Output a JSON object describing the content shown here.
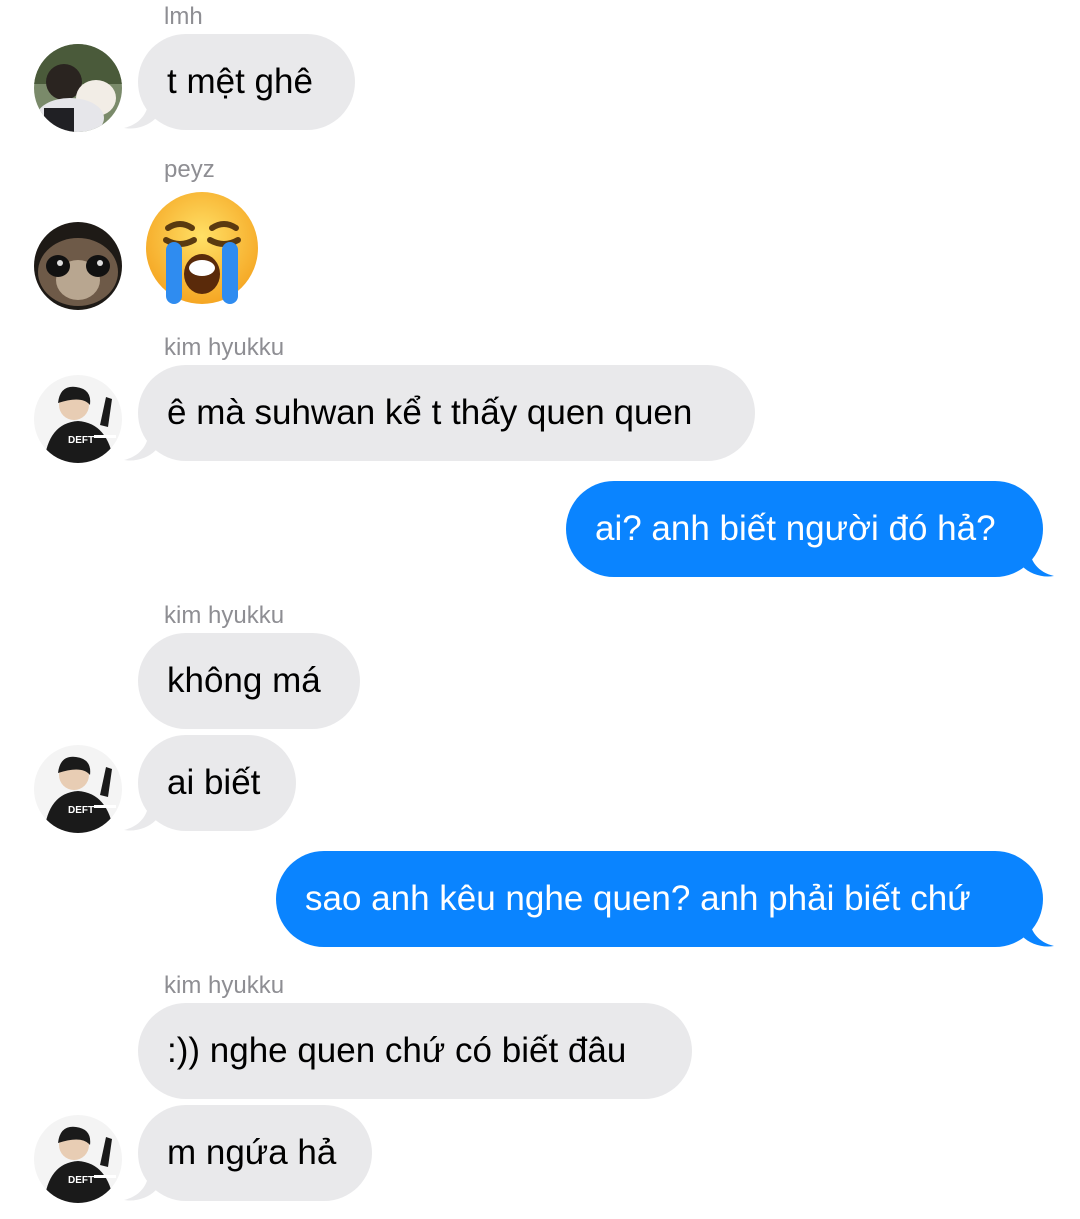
{
  "colors": {
    "incoming_bubble": "#e9e9eb",
    "outgoing_bubble": "#0a84ff",
    "sender_label": "#8e8e93"
  },
  "senders": {
    "lmh": "lmh",
    "peyz": "peyz",
    "kim_hyukku_1": "kim hyukku",
    "kim_hyukku_2": "kim hyukku",
    "kim_hyukku_3": "kim hyukku"
  },
  "messages": {
    "m1": "t mệt ghê",
    "m2_emoji": "loudly-crying-face-emoji",
    "m3": "ê mà suhwan kể t thấy quen quen",
    "m4": "ai? anh biết người đó hả?",
    "m5": "không má",
    "m6": "ai biết",
    "m7": "sao anh kêu nghe quen? anh phải biết chứ",
    "m8": ":)) nghe quen chứ có biết đâu",
    "m9": "m ngứa hả"
  },
  "avatars": {
    "lmh": "avatar-person-holding-dog",
    "peyz": "avatar-cat-closeup",
    "kim_hyukku": "avatar-deft-jersey",
    "jersey_text": "DEFT"
  }
}
